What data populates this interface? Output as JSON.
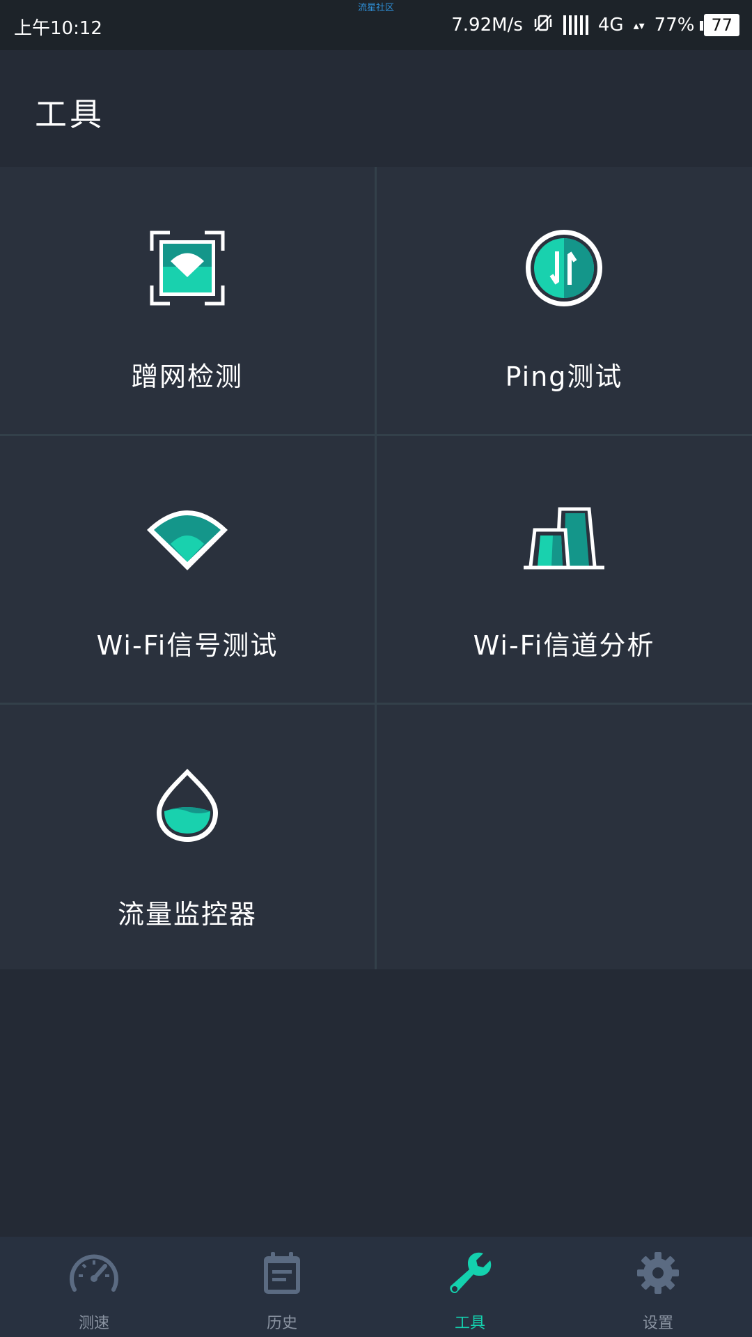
{
  "status_bar": {
    "time": "上午10:12",
    "watermark": "流星社区",
    "net_speed": "7.92M/s",
    "network": "4G",
    "battery_pct": "77%",
    "battery_level": "77"
  },
  "header": {
    "title": "工具"
  },
  "tools": [
    {
      "label": "蹭网检测",
      "icon": "wifi-scan-icon"
    },
    {
      "label": "Ping测试",
      "icon": "ping-arrows-icon"
    },
    {
      "label": "Wi-Fi信号测试",
      "icon": "wifi-signal-icon"
    },
    {
      "label": "Wi-Fi信道分析",
      "icon": "channel-analysis-icon"
    },
    {
      "label": "流量监控器",
      "icon": "data-drop-icon"
    }
  ],
  "bottom_nav": [
    {
      "label": "测速",
      "icon": "speedometer-icon",
      "active": false
    },
    {
      "label": "历史",
      "icon": "history-icon",
      "active": false
    },
    {
      "label": "工具",
      "icon": "wrench-icon",
      "active": true
    },
    {
      "label": "设置",
      "icon": "gear-icon",
      "active": false
    }
  ],
  "colors": {
    "accent": "#14d1ae",
    "accent_dark": "#14968a",
    "background": "#242a35",
    "panel": "#2a313d",
    "nav_inactive": "#5b6b82"
  }
}
